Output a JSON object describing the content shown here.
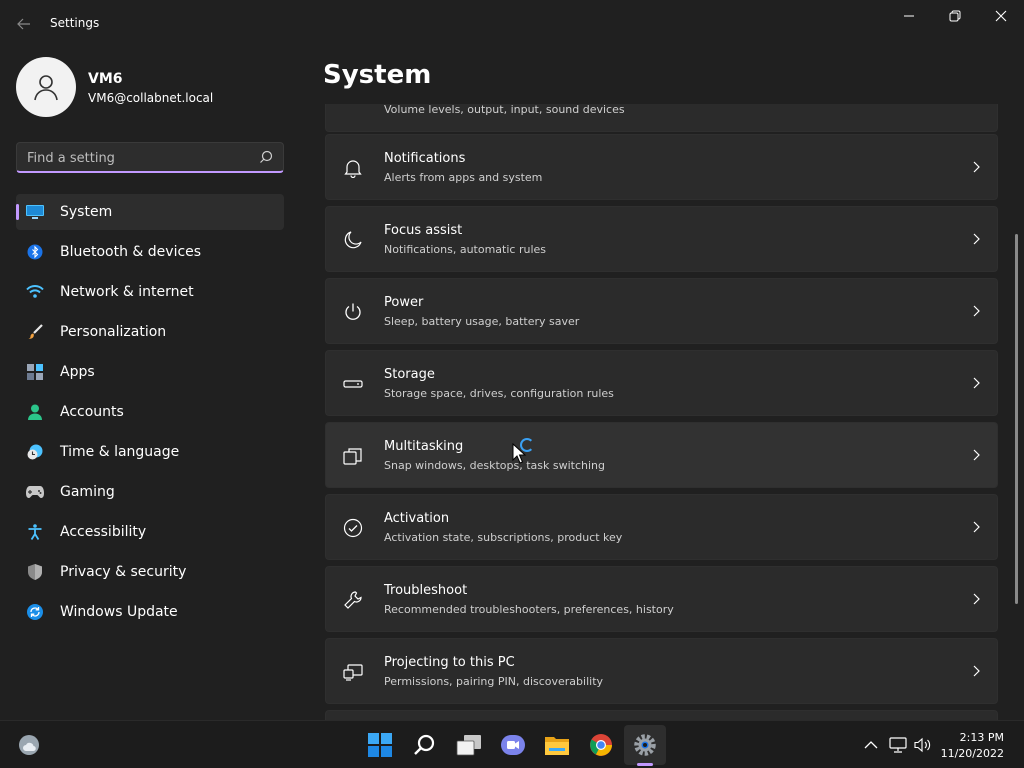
{
  "window": {
    "title": "Settings"
  },
  "user": {
    "name": "VM6",
    "email": "VM6@collabnet.local"
  },
  "search": {
    "placeholder": "Find a setting"
  },
  "sidebar": {
    "items": [
      {
        "label": "System",
        "icon": "monitor-icon",
        "selected": true
      },
      {
        "label": "Bluetooth & devices",
        "icon": "bluetooth-icon"
      },
      {
        "label": "Network & internet",
        "icon": "wifi-icon"
      },
      {
        "label": "Personalization",
        "icon": "brush-icon"
      },
      {
        "label": "Apps",
        "icon": "apps-icon"
      },
      {
        "label": "Accounts",
        "icon": "person-icon"
      },
      {
        "label": "Time & language",
        "icon": "clock-globe-icon"
      },
      {
        "label": "Gaming",
        "icon": "gamepad-icon"
      },
      {
        "label": "Accessibility",
        "icon": "accessibility-icon"
      },
      {
        "label": "Privacy & security",
        "icon": "shield-icon"
      },
      {
        "label": "Windows Update",
        "icon": "update-icon"
      }
    ]
  },
  "main": {
    "title": "System",
    "partial_card": {
      "subtitle": "Volume levels, output, input, sound devices"
    },
    "cards": [
      {
        "title": "Notifications",
        "subtitle": "Alerts from apps and system",
        "icon": "bell-icon"
      },
      {
        "title": "Focus assist",
        "subtitle": "Notifications, automatic rules",
        "icon": "moon-icon"
      },
      {
        "title": "Power",
        "subtitle": "Sleep, battery usage, battery saver",
        "icon": "power-icon"
      },
      {
        "title": "Storage",
        "subtitle": "Storage space, drives, configuration rules",
        "icon": "drive-icon"
      },
      {
        "title": "Multitasking",
        "subtitle": "Snap windows, desktops, task switching",
        "icon": "multitask-icon"
      },
      {
        "title": "Activation",
        "subtitle": "Activation state, subscriptions, product key",
        "icon": "check-circle-icon"
      },
      {
        "title": "Troubleshoot",
        "subtitle": "Recommended troubleshooters, preferences, history",
        "icon": "wrench-icon"
      },
      {
        "title": "Projecting to this PC",
        "subtitle": "Permissions, pairing PIN, discoverability",
        "icon": "project-icon"
      }
    ]
  },
  "taskbar": {
    "apps": [
      "start-icon",
      "search-icon",
      "task-view-icon",
      "chat-icon",
      "file-explorer-icon",
      "chrome-icon",
      "settings-icon"
    ],
    "clock": {
      "time": "2:13 PM",
      "date": "11/20/2022"
    }
  },
  "colors": {
    "accent": "#c299ff",
    "background": "#202020",
    "card": "#2b2b2b",
    "taskbar": "#1c1c1c"
  }
}
